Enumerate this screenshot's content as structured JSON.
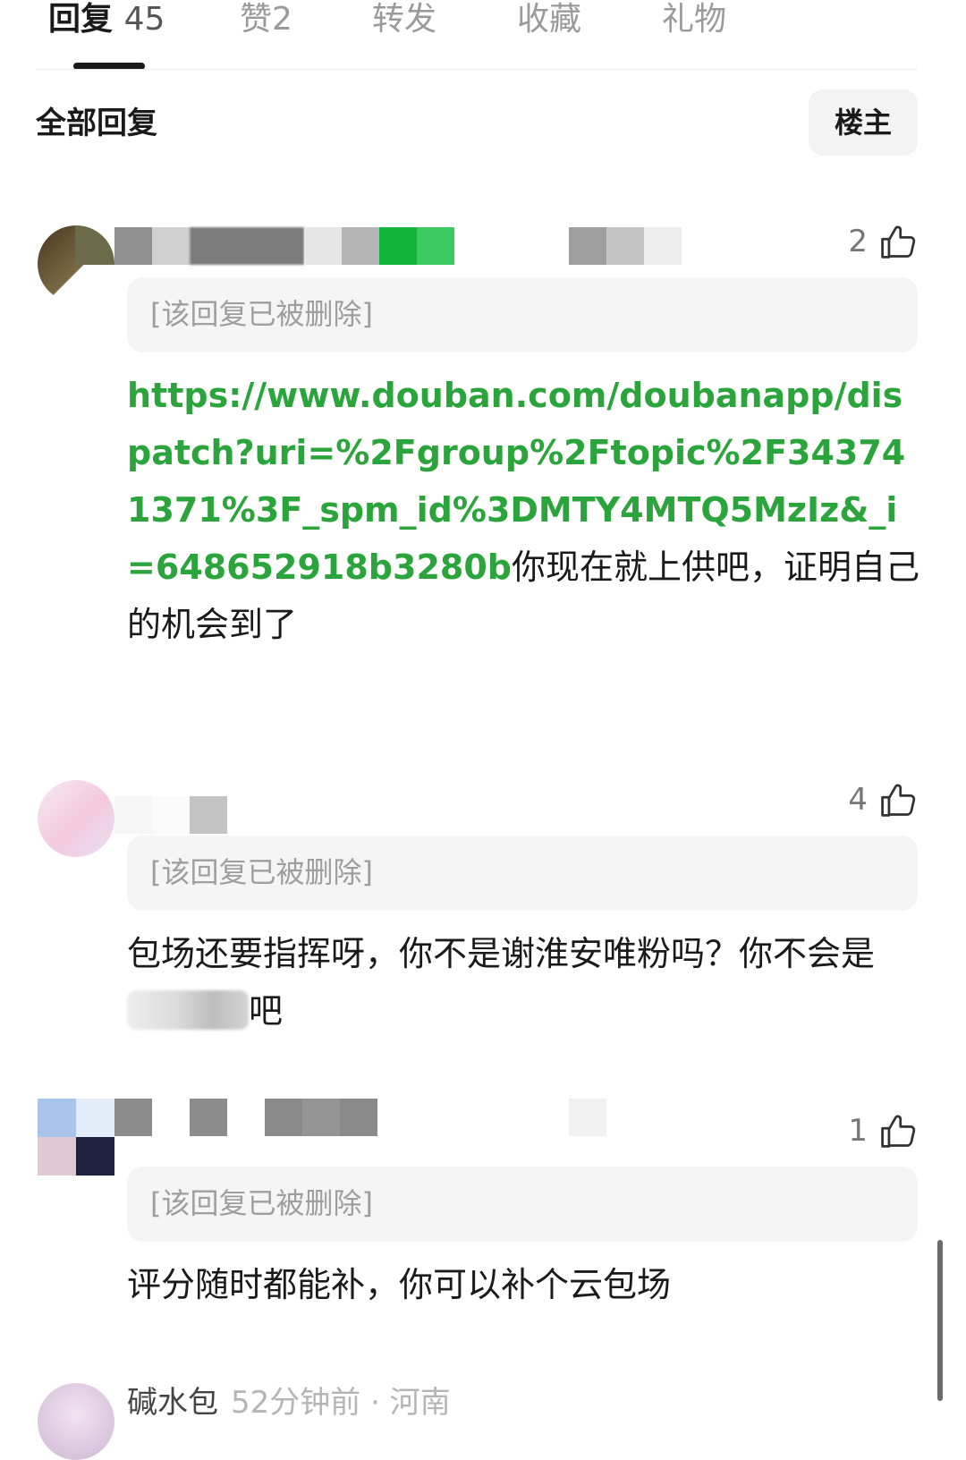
{
  "tabs": [
    {
      "label": "回复",
      "count": "45",
      "active": true
    },
    {
      "label": "赞",
      "count": "2",
      "active": false
    },
    {
      "label": "转发",
      "count": "",
      "active": false
    },
    {
      "label": "收藏",
      "count": "",
      "active": false
    },
    {
      "label": "礼物",
      "count": "",
      "active": false
    }
  ],
  "filter": {
    "title": "全部回复",
    "op_button": "楼主"
  },
  "comments": [
    {
      "likes": "2",
      "quoted": "[该回复已被删除]",
      "link": "https://www.douban.com/doubanapp/dispatch?uri=%2Fgroup%2Ftopic%2F343741371%3F_spm_id%3DMTY4MTQ5MzIz&_i=648652918b3280b",
      "text": "你现在就上供吧，证明自己的机会到了"
    },
    {
      "likes": "4",
      "quoted": "[该回复已被删除]",
      "text_before": "包场还要指挥呀，你不是谢淮安唯粉吗？你不会是",
      "text_after": "吧"
    },
    {
      "likes": "1",
      "quoted": "[该回复已被删除]",
      "text": "评分随时都能补，你可以补个云包场"
    }
  ],
  "next_comment": {
    "name": "碱水包",
    "time": "52分钟前 · 河南"
  },
  "colors": {
    "link": "#2aa43b",
    "text": "#1a1a1a",
    "muted": "#9e9e9e",
    "quote_bg": "#f5f5f5"
  }
}
